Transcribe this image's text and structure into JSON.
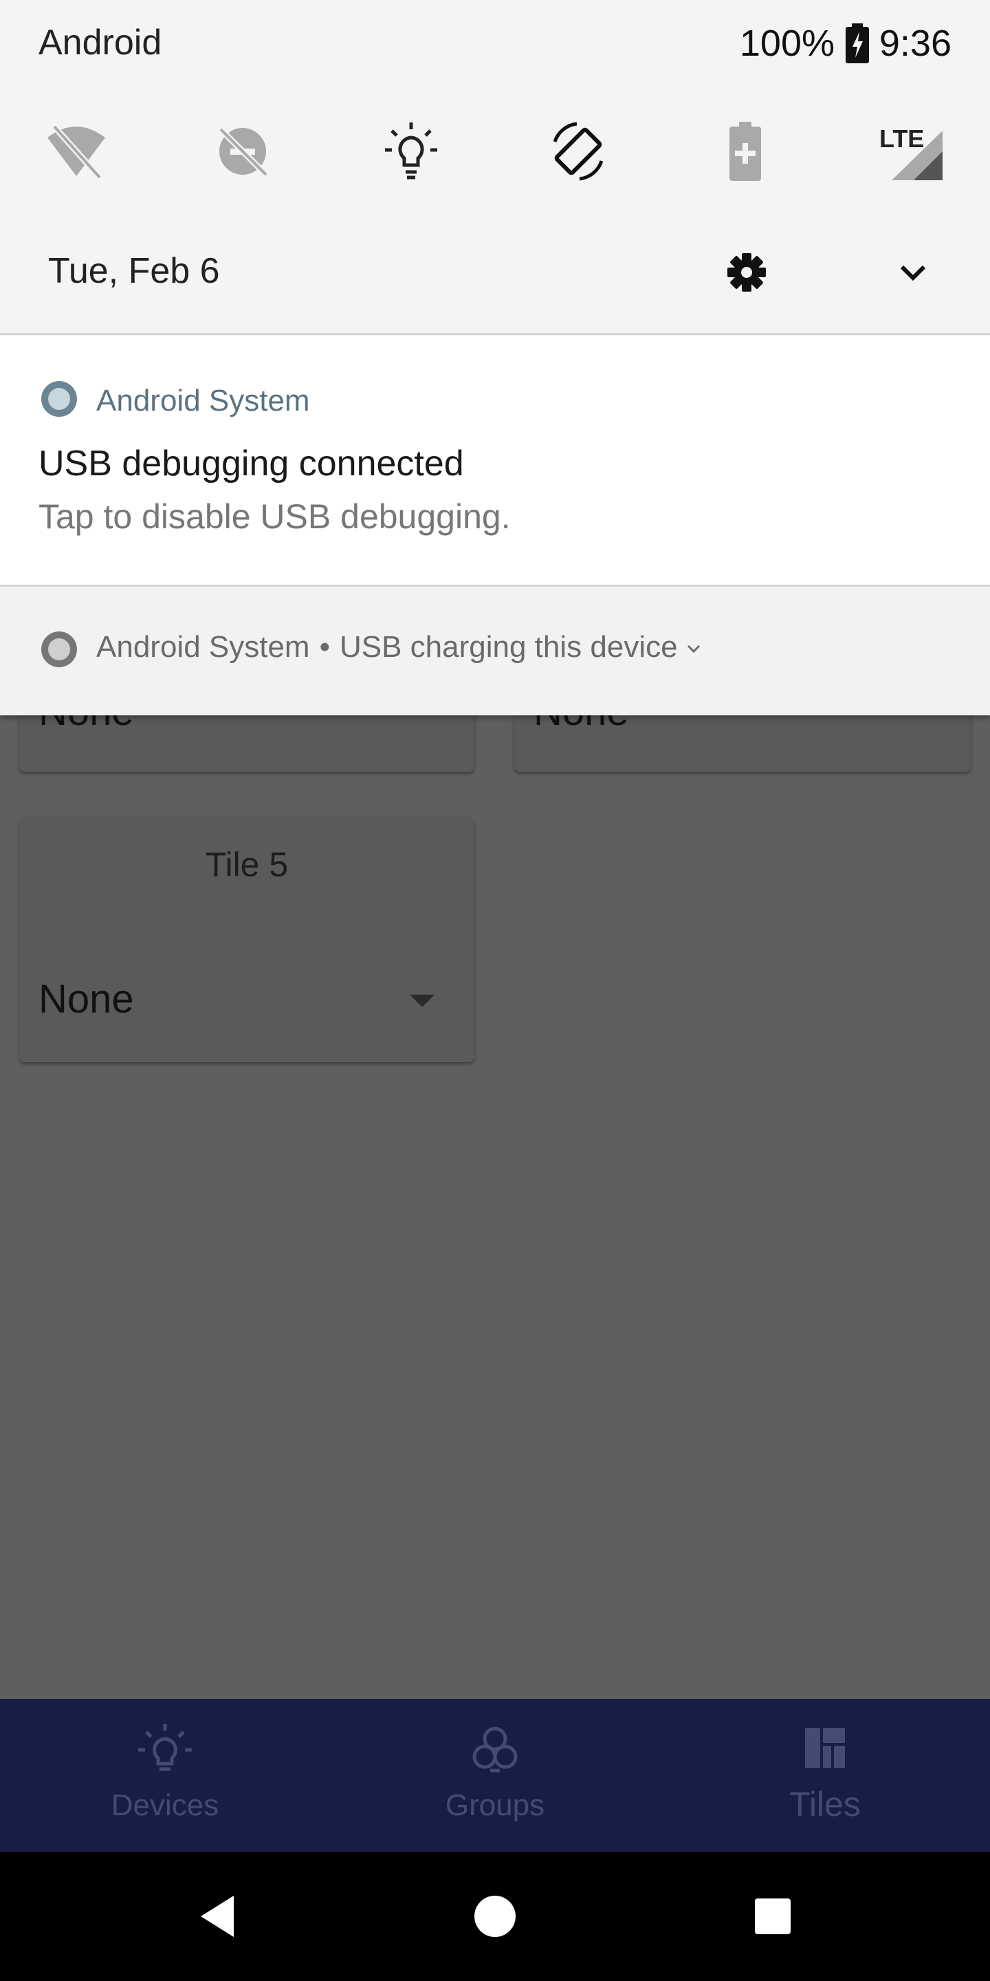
{
  "status_bar": {
    "carrier": "Android",
    "battery_percent": "100%",
    "time": "9:36"
  },
  "quick_settings": {
    "tiles": [
      {
        "icon": "wifi-off-icon"
      },
      {
        "icon": "do-not-disturb-off-icon"
      },
      {
        "icon": "flashlight-icon"
      },
      {
        "icon": "auto-rotate-icon"
      },
      {
        "icon": "battery-saver-icon"
      },
      {
        "icon": "lte-signal-icon"
      }
    ]
  },
  "shade_header": {
    "date": "Tue, Feb 6"
  },
  "notifications": [
    {
      "app": "Android System",
      "title": "USB debugging connected",
      "text": "Tap to disable USB debugging."
    },
    {
      "app": "Android System",
      "separator": "•",
      "summary": "USB charging this device"
    }
  ],
  "background_app": {
    "partial_tiles": [
      {
        "value": "None"
      },
      {
        "value": "None"
      }
    ],
    "tile5": {
      "title": "Tile 5",
      "value": "None"
    },
    "bottom_nav": [
      {
        "label": "Devices",
        "icon": "lightbulb-icon"
      },
      {
        "label": "Groups",
        "icon": "groups-icon"
      },
      {
        "label": "Tiles",
        "icon": "tiles-icon"
      }
    ]
  },
  "colors": {
    "shade_bg": "#f4f4f4",
    "nav_bg": "#181d47",
    "scrim": "#5f5f5f",
    "notif_app": "#5b7282"
  }
}
